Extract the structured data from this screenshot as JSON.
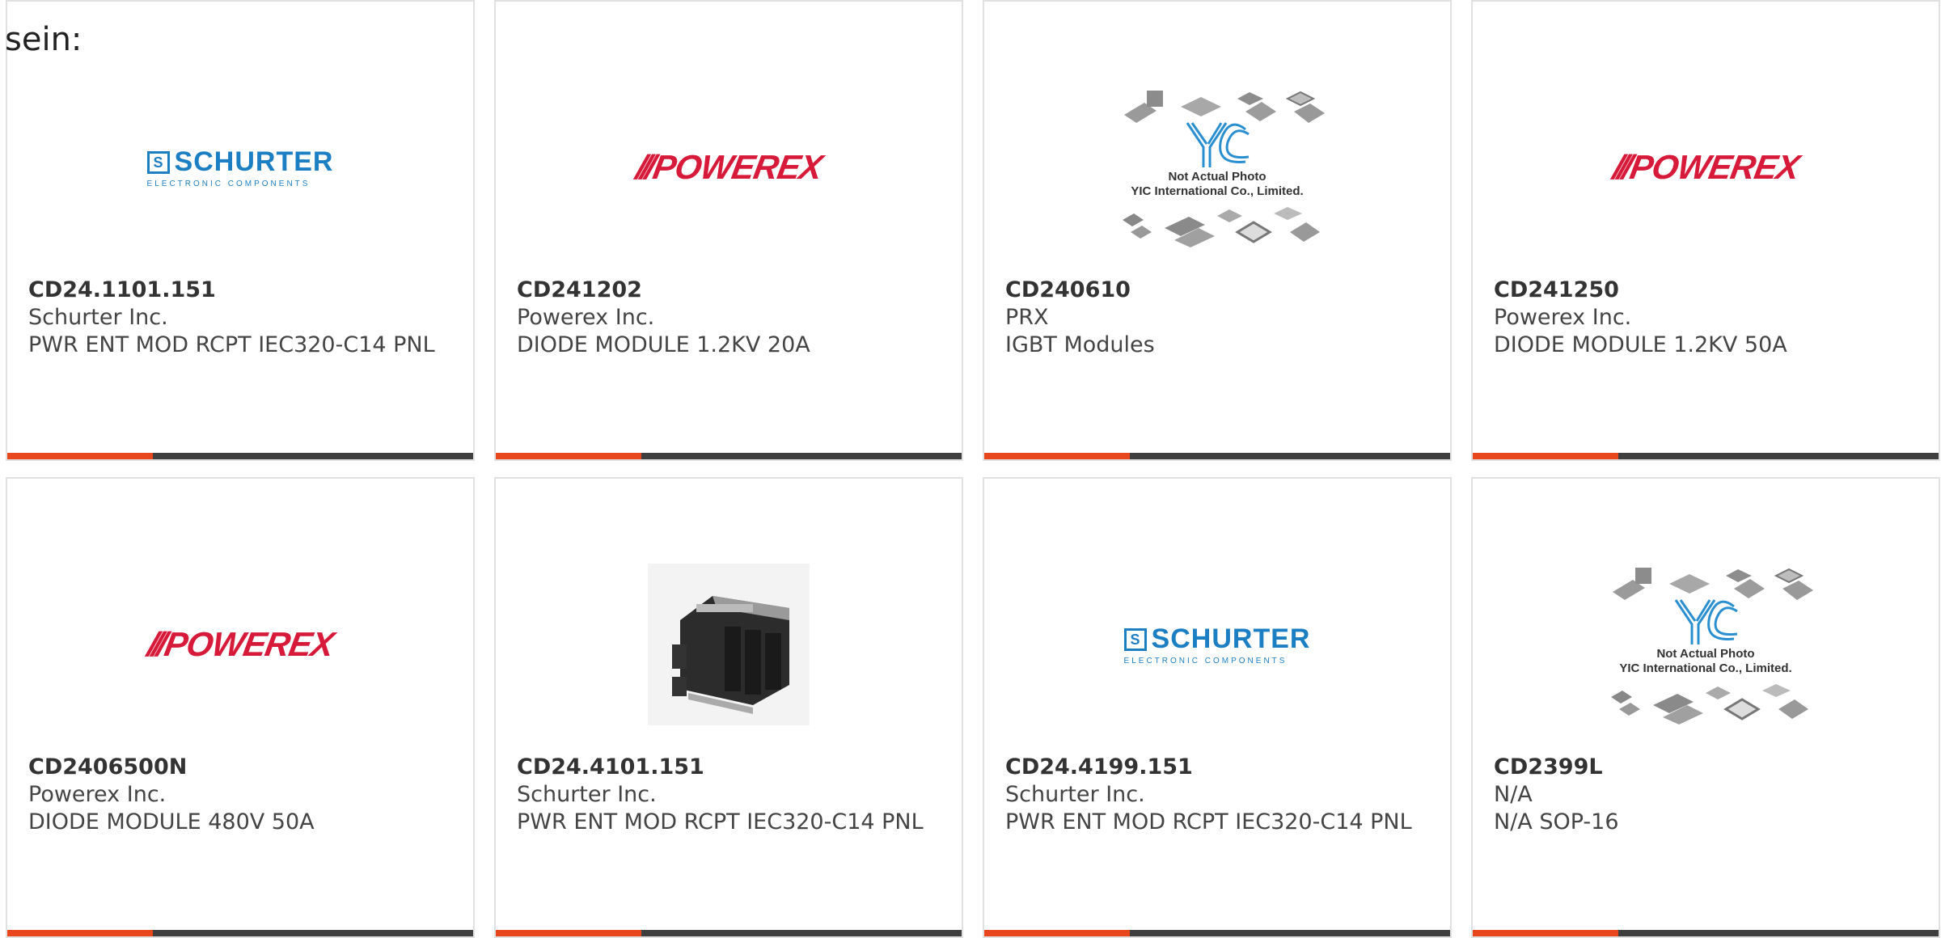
{
  "intro_text": "sein:",
  "colors": {
    "accent": "#e8461c",
    "bar_dark": "#3f3f3f",
    "schurter_blue": "#1d7fc3",
    "powerex_red": "#d7193a"
  },
  "products": [
    {
      "part_no": "CD24.1101.151",
      "maker": "Schurter Inc.",
      "desc": "PWR ENT MOD RCPT IEC320-C14 PNL",
      "image": "schurter-logo"
    },
    {
      "part_no": "CD241202",
      "maker": "Powerex Inc.",
      "desc": "DIODE MODULE 1.2KV 20A",
      "image": "powerex-logo"
    },
    {
      "part_no": "CD240610",
      "maker": "PRX",
      "desc": "IGBT Modules",
      "image": "yic-placeholder"
    },
    {
      "part_no": "CD241250",
      "maker": "Powerex Inc.",
      "desc": "DIODE MODULE 1.2KV 50A",
      "image": "powerex-logo"
    },
    {
      "part_no": "CD2406500N",
      "maker": "Powerex Inc.",
      "desc": "DIODE MODULE 480V 50A",
      "image": "powerex-logo"
    },
    {
      "part_no": "CD24.4101.151",
      "maker": "Schurter Inc.",
      "desc": "PWR ENT MOD RCPT IEC320-C14 PNL",
      "image": "product-photo"
    },
    {
      "part_no": "CD24.4199.151",
      "maker": "Schurter Inc.",
      "desc": "PWR ENT MOD RCPT IEC320-C14 PNL",
      "image": "schurter-logo"
    },
    {
      "part_no": "CD2399L",
      "maker": "N/A",
      "desc": "N/A SOP-16",
      "image": "yic-placeholder"
    }
  ],
  "logos": {
    "schurter_word": "SCHURTER",
    "schurter_sub": "ELECTRONIC COMPONENTS",
    "schurter_mark": "S",
    "powerex_word": "POWEREX",
    "yic_line1": "Not Actual Photo",
    "yic_line2": "YIC International Co., Limited."
  }
}
